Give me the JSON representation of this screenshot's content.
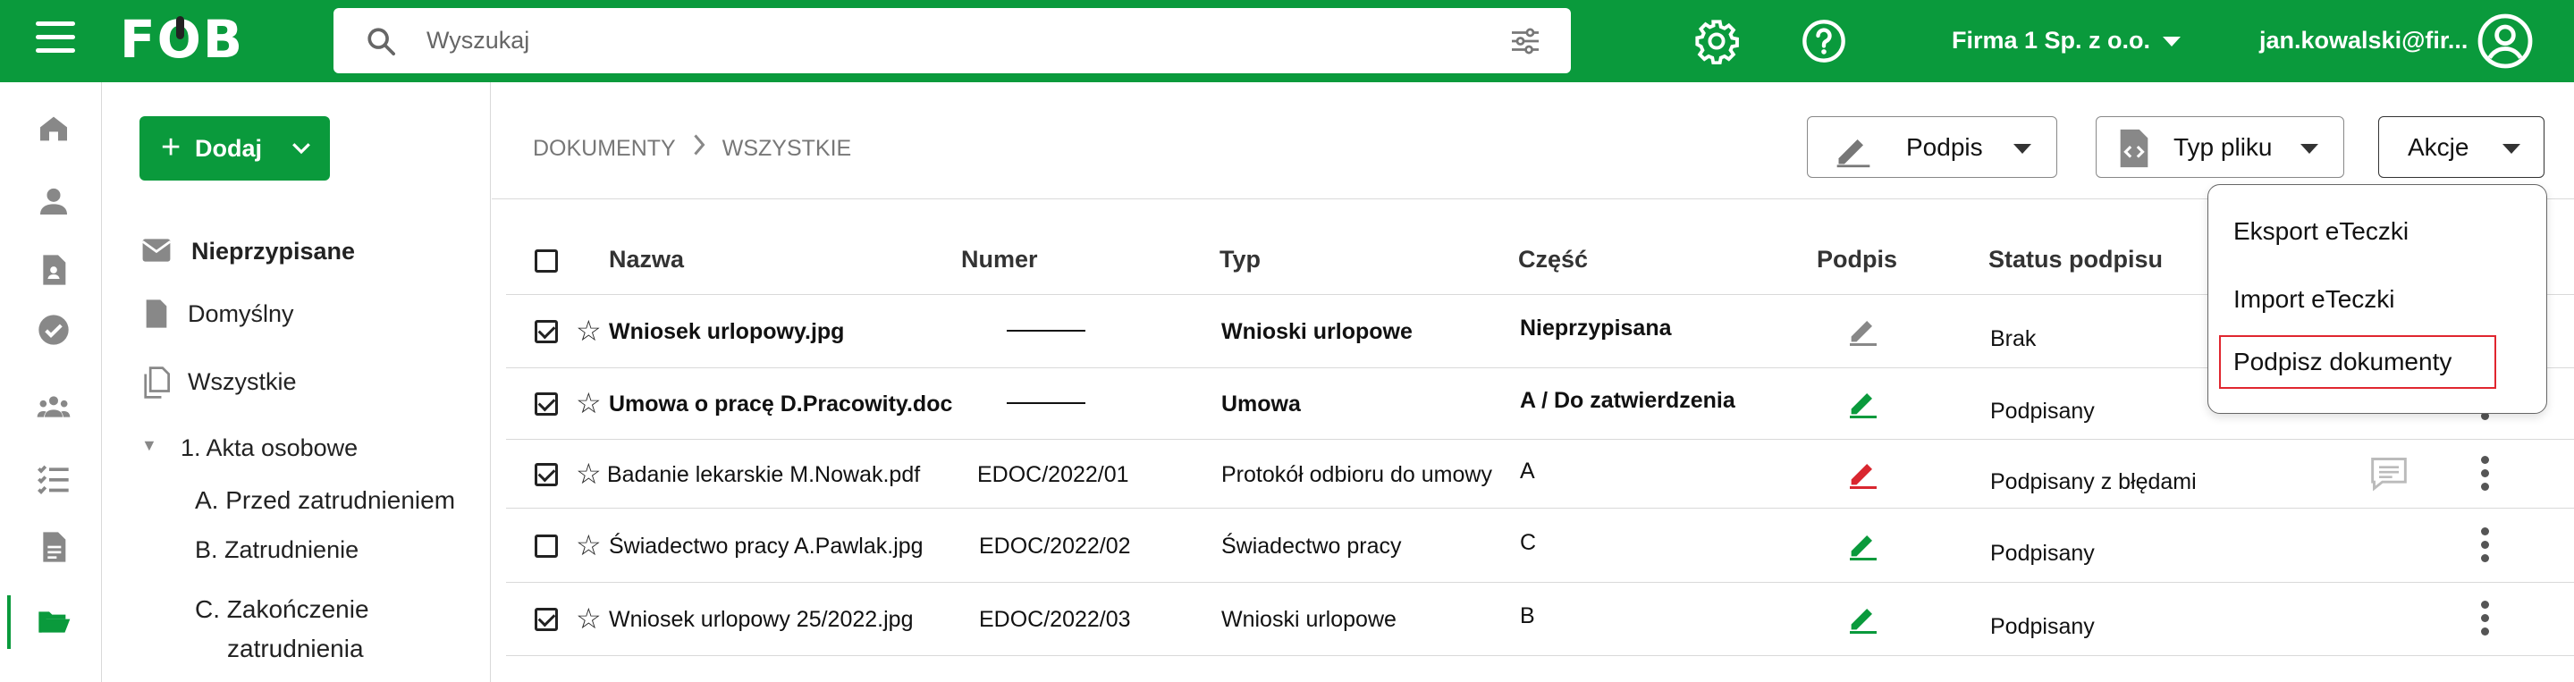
{
  "app": {
    "logo": "FOB",
    "search_placeholder": "Wyszukaj",
    "company": "Firma 1 Sp. z o.o.",
    "user": "jan.kowalski@fir...",
    "brand_color": "#0a9a3c"
  },
  "icons": {
    "menu": "hamburger-icon",
    "search": "search-icon",
    "filter": "sliders-icon",
    "settings": "gear-icon",
    "help": "help-circle-icon",
    "account": "user-circle-icon"
  },
  "rail": [
    "home-icon",
    "person-icon",
    "id-document-icon",
    "check-circle-icon",
    "group-icon",
    "checklist-icon",
    "document-icon",
    "folder-open-icon"
  ],
  "sidebar": {
    "add_label": "Dodaj",
    "items": [
      {
        "label": "Nieprzypisane"
      },
      {
        "label": "Domyślny"
      },
      {
        "label": "Wszystkie"
      },
      {
        "label": "1. Akta osobowe"
      },
      {
        "label": "A. Przed zatrudnieniem"
      },
      {
        "label": "B. Zatrudnienie"
      },
      {
        "label": "C. Zakończenie"
      },
      {
        "label": "zatrudnienia"
      }
    ]
  },
  "breadcrumb": [
    "DOKUMENTY",
    "WSZYSTKIE"
  ],
  "toolbar": {
    "signature": "Podpis",
    "file_type": "Typ pliku",
    "actions": "Akcje"
  },
  "actions_menu": [
    "Eksport eTeczki",
    "Import eTeczki",
    "Podpisz dokumenty"
  ],
  "table": {
    "columns": [
      "Nazwa",
      "Numer",
      "Typ",
      "Część",
      "Podpis",
      "Status podpisu"
    ],
    "rows": [
      {
        "checked": true,
        "name": "Wniosek urlopowy.jpg",
        "number": "",
        "type": "Wnioski urlopowe",
        "part": "Nieprzypisana",
        "sign": "grey",
        "status": "Brak",
        "bold": true
      },
      {
        "checked": true,
        "name": "Umowa o pracę D.Pracowity.doc",
        "number": "",
        "type": "Umowa",
        "part": "A / Do zatwierdzenia",
        "sign": "green",
        "status": "Podpisany",
        "bold": true
      },
      {
        "checked": true,
        "name": "Badanie lekarskie M.Nowak.pdf",
        "number": "EDOC/2022/01",
        "type": "Protokół odbioru do umowy",
        "part": "A",
        "sign": "red",
        "status": "Podpisany z błędami",
        "bold": false
      },
      {
        "checked": false,
        "name": "Świadectwo pracy A.Pawlak.jpg",
        "number": "EDOC/2022/02",
        "type": "Świadectwo pracy",
        "part": "C",
        "sign": "green",
        "status": "Podpisany",
        "bold": false
      },
      {
        "checked": true,
        "name": "Wniosek urlopowy 25/2022.jpg",
        "number": "EDOC/2022/03",
        "type": "Wnioski urlopowe",
        "part": "B",
        "sign": "green",
        "status": "Podpisany",
        "bold": false
      }
    ]
  },
  "sign_colors": {
    "grey": "#888888",
    "green": "#0a9a3c",
    "red": "#d9262f"
  }
}
